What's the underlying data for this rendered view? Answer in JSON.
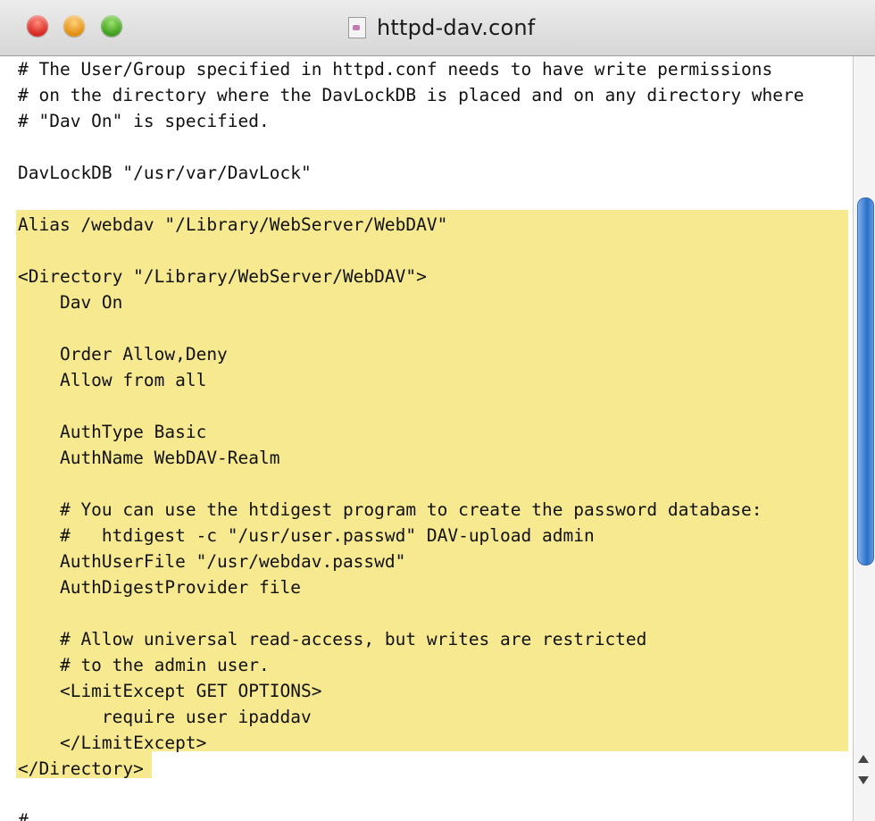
{
  "window": {
    "title": "httpd-dav.conf"
  },
  "lines": [
    "# The User/Group specified in httpd.conf needs to have write permissions",
    "# on the directory where the DavLockDB is placed and on any directory where",
    "# \"Dav On\" is specified.",
    "",
    "DavLockDB \"/usr/var/DavLock\"",
    "",
    "Alias /webdav \"/Library/WebServer/WebDAV\"",
    "",
    "<Directory \"/Library/WebServer/WebDAV\">",
    "    Dav On",
    "",
    "    Order Allow,Deny",
    "    Allow from all",
    "",
    "    AuthType Basic",
    "    AuthName WebDAV-Realm",
    "",
    "    # You can use the htdigest program to create the password database:",
    "    #   htdigest -c \"/usr/user.passwd\" DAV-upload admin",
    "    AuthUserFile \"/usr/webdav.passwd\"",
    "    AuthDigestProvider file",
    "",
    "    # Allow universal read-access, but writes are restricted",
    "    # to the admin user.",
    "    <LimitExcept GET OPTIONS>",
    "        require user ipaddav",
    "    </LimitExcept>",
    "</Directory>",
    "",
    "#"
  ]
}
